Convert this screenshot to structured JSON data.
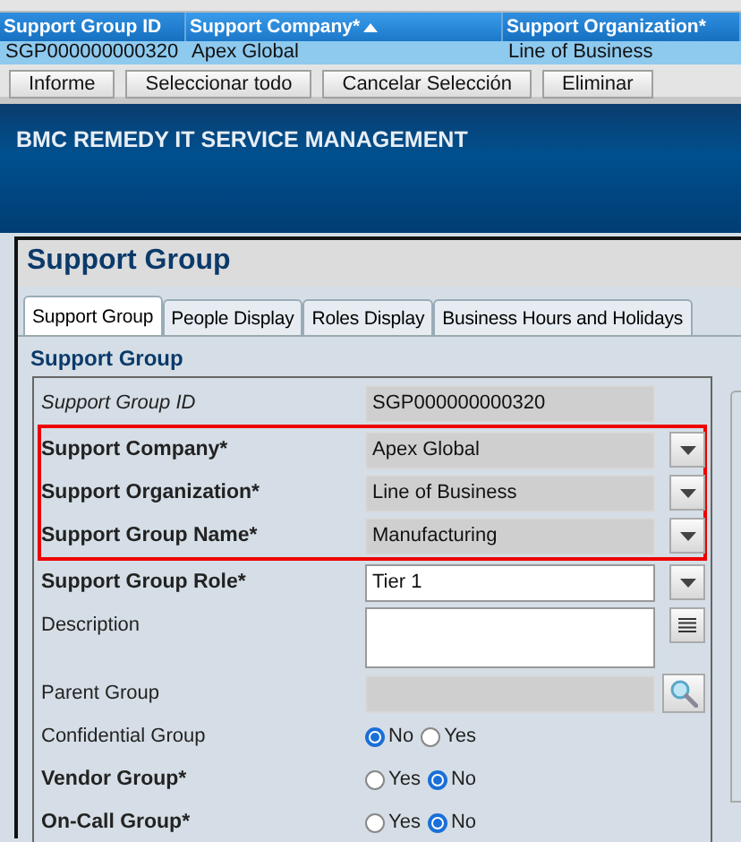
{
  "results_table": {
    "columns": [
      {
        "label": "Support Group ID",
        "sorted": false
      },
      {
        "label": "Support Company*",
        "sorted": true
      },
      {
        "label": "Support Organization*",
        "sorted": false
      }
    ],
    "rows": [
      {
        "cells": [
          "SGP000000000320",
          "Apex Global",
          "Line of Business"
        ],
        "selected": true
      }
    ]
  },
  "table_buttons": [
    "Informe",
    "Seleccionar todo",
    "Cancelar Selección",
    "Eliminar"
  ],
  "banner": {
    "title": "BMC REMEDY IT SERVICE MANAGEMENT"
  },
  "panel": {
    "title": "Support Group",
    "tabs": [
      {
        "label": "Support Group",
        "selected": true
      },
      {
        "label": "People Display",
        "selected": false
      },
      {
        "label": "Roles Display",
        "selected": false
      },
      {
        "label": "Business Hours and Holidays",
        "selected": false
      }
    ],
    "section": "Support Group",
    "fields": [
      {
        "kind": "text",
        "label": "Support Group ID",
        "required": false,
        "read_only": true,
        "value": "SGP000000000320",
        "disabled": true,
        "highlighted": false
      },
      {
        "kind": "dropdown",
        "label": "Support Company*",
        "required": true,
        "read_only": false,
        "value": "Apex Global",
        "disabled": true,
        "highlighted": true
      },
      {
        "kind": "dropdown",
        "label": "Support Organization*",
        "required": true,
        "read_only": false,
        "value": "Line of Business",
        "disabled": true,
        "highlighted": true
      },
      {
        "kind": "dropdown",
        "label": "Support Group Name*",
        "required": true,
        "read_only": false,
        "value": "Manufacturing",
        "disabled": true,
        "highlighted": true
      },
      {
        "kind": "dropdown",
        "label": "Support Group Role*",
        "required": true,
        "read_only": false,
        "value": "Tier 1",
        "disabled": false,
        "highlighted": false
      },
      {
        "kind": "textarea",
        "label": "Description",
        "required": false,
        "read_only": false,
        "disabled": false,
        "highlighted": false
      },
      {
        "kind": "lookup",
        "label": "Parent Group",
        "required": false,
        "read_only": false,
        "disabled": true,
        "highlighted": false
      },
      {
        "kind": "radio",
        "label": "Confidential Group",
        "required": false,
        "read_only": false,
        "highlighted": false,
        "options": [
          {
            "label": "No",
            "selected": true
          },
          {
            "label": "Yes",
            "selected": false
          }
        ]
      },
      {
        "kind": "radio",
        "label": "Vendor Group*",
        "required": true,
        "read_only": false,
        "highlighted": false,
        "options": [
          {
            "label": "Yes",
            "selected": false
          },
          {
            "label": "No",
            "selected": true
          }
        ]
      },
      {
        "kind": "radio",
        "label": "On-Call Group*",
        "required": true,
        "read_only": false,
        "highlighted": false,
        "options": [
          {
            "label": "Yes",
            "selected": false
          },
          {
            "label": "No",
            "selected": true
          }
        ]
      }
    ]
  }
}
